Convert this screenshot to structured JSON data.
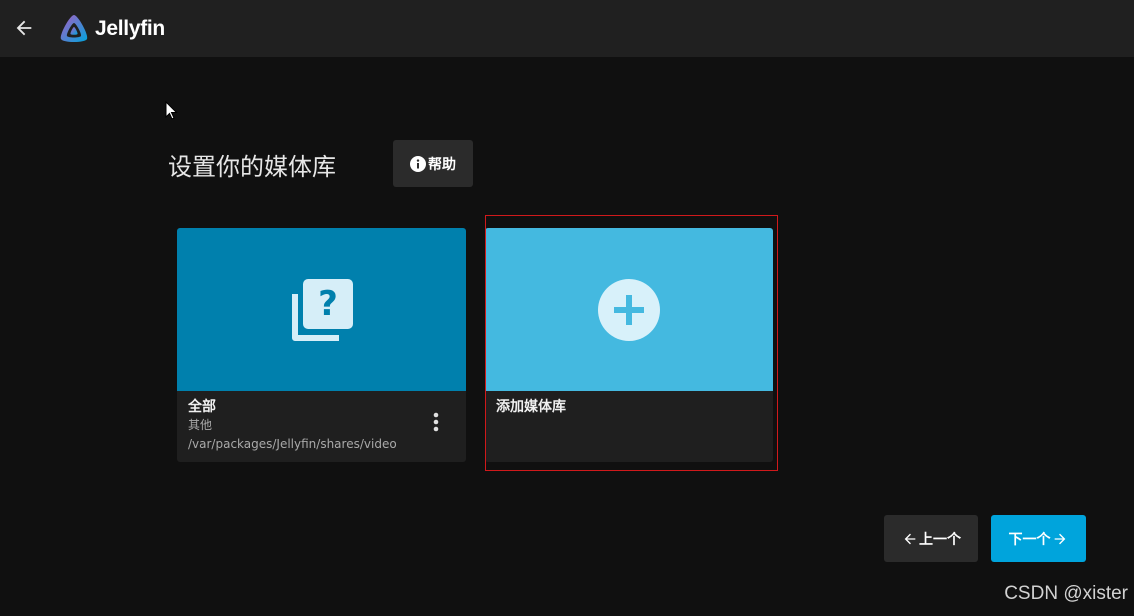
{
  "header": {
    "app_name": "Jellyfin"
  },
  "main": {
    "title": "设置你的媒体库",
    "help_label": "帮助"
  },
  "libraries": [
    {
      "name": "全部",
      "type": "其他",
      "path": "/var/packages/Jellyfin/shares/video",
      "icon": "library-unknown-icon",
      "color": "#0080ad"
    },
    {
      "name": "添加媒体库",
      "icon": "add-icon",
      "color": "#44b9e0"
    }
  ],
  "nav": {
    "prev_label": "上一个",
    "next_label": "下一个"
  },
  "watermark": "CSDN @xister",
  "colors": {
    "accent": "#00a4dc",
    "highlight_border": "#d0191b"
  }
}
